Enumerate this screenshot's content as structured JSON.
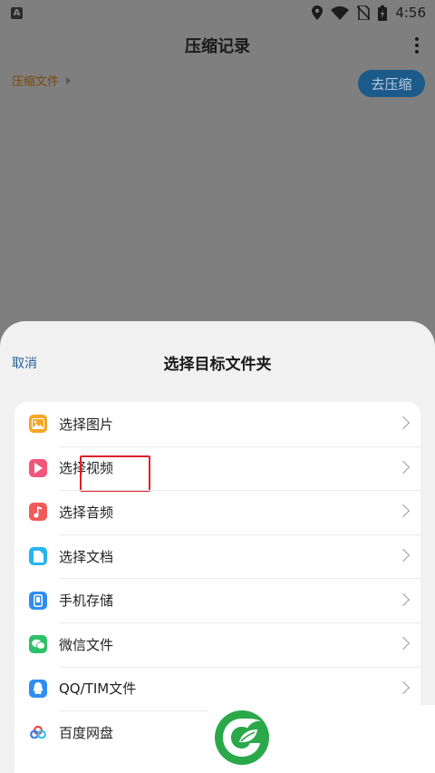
{
  "status_bar": {
    "app_indicator": "A",
    "time": "4:56",
    "icons": [
      "location-icon",
      "wifi-icon",
      "no-sim-icon",
      "battery-icon"
    ]
  },
  "app_bar": {
    "title": "压缩记录",
    "menu_icon": "more-vertical-icon"
  },
  "breadcrumb": {
    "label": "压缩文件"
  },
  "go_compress_button": {
    "label": "去压缩"
  },
  "sheet": {
    "cancel_label": "取消",
    "title": "选择目标文件夹",
    "items": [
      {
        "label": "选择图片",
        "icon": "image-icon",
        "color": "#f5a623"
      },
      {
        "label": "选择视频",
        "icon": "video-icon",
        "color": "#f1567b"
      },
      {
        "label": "选择音频",
        "icon": "music-icon",
        "color": "#f05a5a"
      },
      {
        "label": "选择文档",
        "icon": "document-icon",
        "color": "#27b5f0"
      },
      {
        "label": "手机存储",
        "icon": "phone-icon",
        "color": "#2f8df2"
      },
      {
        "label": "微信文件",
        "icon": "wechat-icon",
        "color": "#2fc06a"
      },
      {
        "label": "QQ/TIM文件",
        "icon": "qq-icon",
        "color": "#2f8df2"
      },
      {
        "label": "百度网盘",
        "icon": "baidu-netdisk-icon",
        "color": "#3a7bf0"
      }
    ]
  },
  "colors": {
    "accent": "#1f5f98",
    "highlight_box": "#e0202a"
  }
}
